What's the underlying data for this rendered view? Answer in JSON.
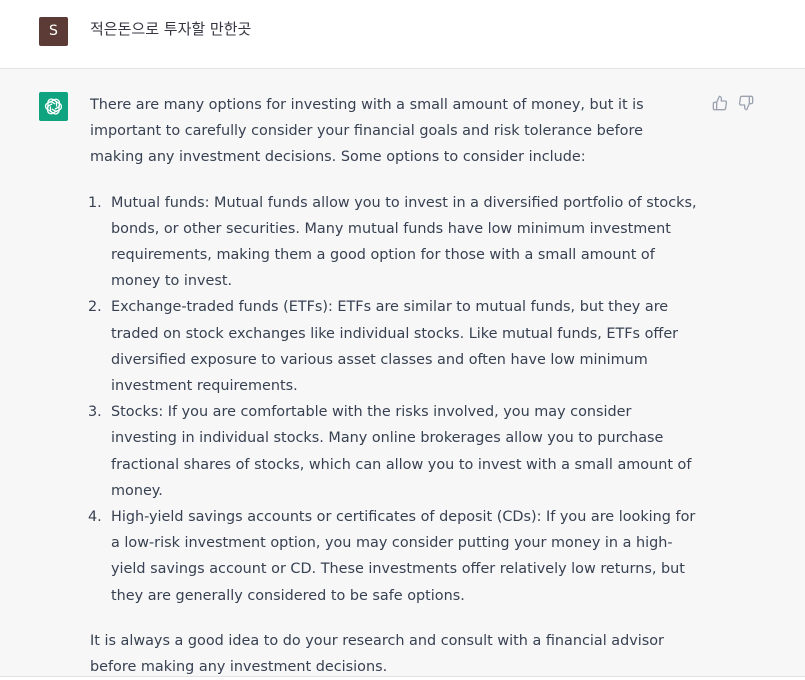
{
  "user": {
    "avatar_letter": "S",
    "message": "적은돈으로 투자할 만한곳"
  },
  "assistant": {
    "avatar_icon": "openai-logo-icon",
    "feedback": {
      "thumbs_up_icon": "thumbs-up-icon",
      "thumbs_down_icon": "thumbs-down-icon"
    },
    "intro": "There are many options for investing with a small amount of money, but it is important to carefully consider your financial goals and risk tolerance before making any investment decisions. Some options to consider include:",
    "items": [
      {
        "number": "1.",
        "text": "Mutual funds: Mutual funds allow you to invest in a diversified portfolio of stocks, bonds, or other securities. Many mutual funds have low minimum investment requirements, making them a good option for those with a small amount of money to invest."
      },
      {
        "number": "2.",
        "text": "Exchange-traded funds (ETFs): ETFs are similar to mutual funds, but they are traded on stock exchanges like individual stocks. Like mutual funds, ETFs offer diversified exposure to various asset classes and often have low minimum investment requirements."
      },
      {
        "number": "3.",
        "text": "Stocks: If you are comfortable with the risks involved, you may consider investing in individual stocks. Many online brokerages allow you to purchase fractional shares of stocks, which can allow you to invest with a small amount of money."
      },
      {
        "number": "4.",
        "text": "High-yield savings accounts or certificates of deposit (CDs): If you are looking for a low-risk investment option, you may consider putting your money in a high-yield savings account or CD. These investments offer relatively low returns, but they are generally considered to be safe options."
      }
    ],
    "closing": "It is always a good idea to do your research and consult with a financial advisor before making any investment decisions."
  },
  "colors": {
    "user_avatar_bg": "#5c3b36",
    "assistant_avatar_bg": "#10a37f",
    "assistant_row_bg": "#f7f7f8",
    "text": "#374151"
  }
}
